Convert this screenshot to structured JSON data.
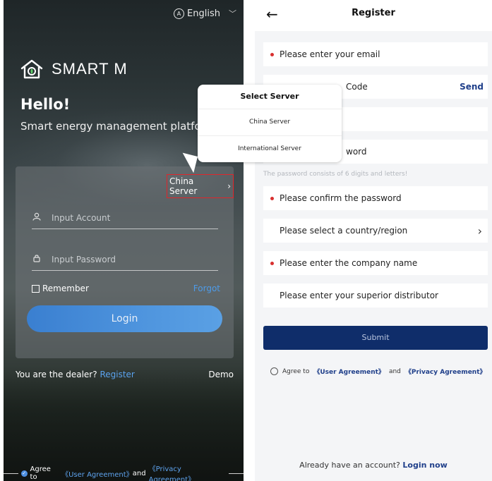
{
  "login": {
    "language": "English",
    "brand": "SMART M",
    "hello": "Hello!",
    "tagline": "Smart energy management platform",
    "server_link": "China Server",
    "account_placeholder": "Input Account",
    "password_placeholder": "Input Password",
    "remember": "Remember",
    "forgot": "Forgot",
    "login_button": "Login",
    "dealer_text": "You are the dealer?",
    "register_link": "Register",
    "demo": "Demo",
    "agree_prefix": "Agree to",
    "user_agreement": "《User Agreement》",
    "and": "and",
    "privacy_agreement": "《Privacy Agreement》"
  },
  "server_popup": {
    "title": "Select Server",
    "options": [
      "China Server",
      "International Server"
    ]
  },
  "register": {
    "back_icon": "arrow-left-icon",
    "title": "Register",
    "email_placeholder": "Please enter your email",
    "code_placeholder": "Code",
    "send": "Send",
    "password_placeholder": "word",
    "password_hint": "The password consists of 6 digits and letters!",
    "confirm_placeholder": "Please confirm the password",
    "country_placeholder": "Please select a country/region",
    "company_placeholder": "Please enter the company name",
    "distributor_placeholder": "Please enter your superior distributor",
    "submit": "Submit",
    "agree_prefix": "Agree to",
    "user_agreement": "《User Agreement》",
    "and": "and",
    "privacy_agreement": "《Privacy Agreement》",
    "have_account": "Already have an account?",
    "login_now": "Login now"
  },
  "colors": {
    "accent_blue": "#4d9be8",
    "navy": "#0f2d6a",
    "required_red": "#d8302f",
    "highlight_red": "#e0262b"
  }
}
